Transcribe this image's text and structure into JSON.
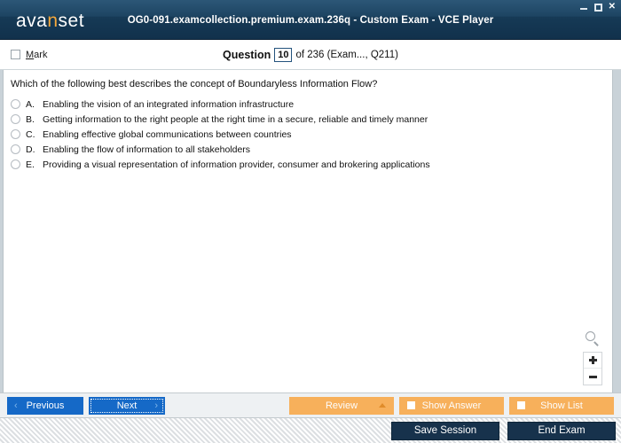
{
  "titlebar": {
    "logo_text_a": "ava",
    "logo_text_n": "n",
    "logo_text_b": "set",
    "title": "OG0-091.examcollection.premium.exam.236q - Custom Exam - VCE Player",
    "minimize_label": "Minimize",
    "maximize_label": "Maximize",
    "close_label": "✕",
    "bg_color": "#1d4462",
    "accent_color": "#f5a83c"
  },
  "question_header": {
    "mark_label": "Mark",
    "mark_accel": "M",
    "mark_rest": "ark",
    "mark_checked": false,
    "question_word": "Question",
    "question_number": "10",
    "rest_text": "of 236 (Exam..., Q211)"
  },
  "question": {
    "text": "Which of the following best describes the concept of Boundaryless Information Flow?",
    "options": [
      {
        "letter": "A.",
        "text": "Enabling the vision of an integrated information infrastructure",
        "selected": false
      },
      {
        "letter": "B.",
        "text": "Getting information to the right people at the right time in a secure, reliable and timely manner",
        "selected": false
      },
      {
        "letter": "C.",
        "text": "Enabling effective global communications between countries",
        "selected": false
      },
      {
        "letter": "D.",
        "text": "Enabling the flow of information to all stakeholders",
        "selected": false
      },
      {
        "letter": "E.",
        "text": "Providing a visual representation of information provider, consumer and brokering applications",
        "selected": false
      }
    ]
  },
  "zoom_tools": {
    "magnifier_icon": "magnifier-icon",
    "zoom_in_label": "+",
    "zoom_out_label": "−"
  },
  "navbar": {
    "previous_label": "Previous",
    "previous_chevron": "‹",
    "next_label": "Next",
    "next_chevron": "›",
    "review_label": "Review",
    "show_answer_label": "Show Answer",
    "show_list_label": "Show List",
    "button_color_blue": "#1569c7",
    "button_color_orange": "#f7b05b"
  },
  "statusbar": {
    "save_session_label": "Save Session",
    "end_exam_label": "End Exam",
    "button_color": "#17324c"
  }
}
